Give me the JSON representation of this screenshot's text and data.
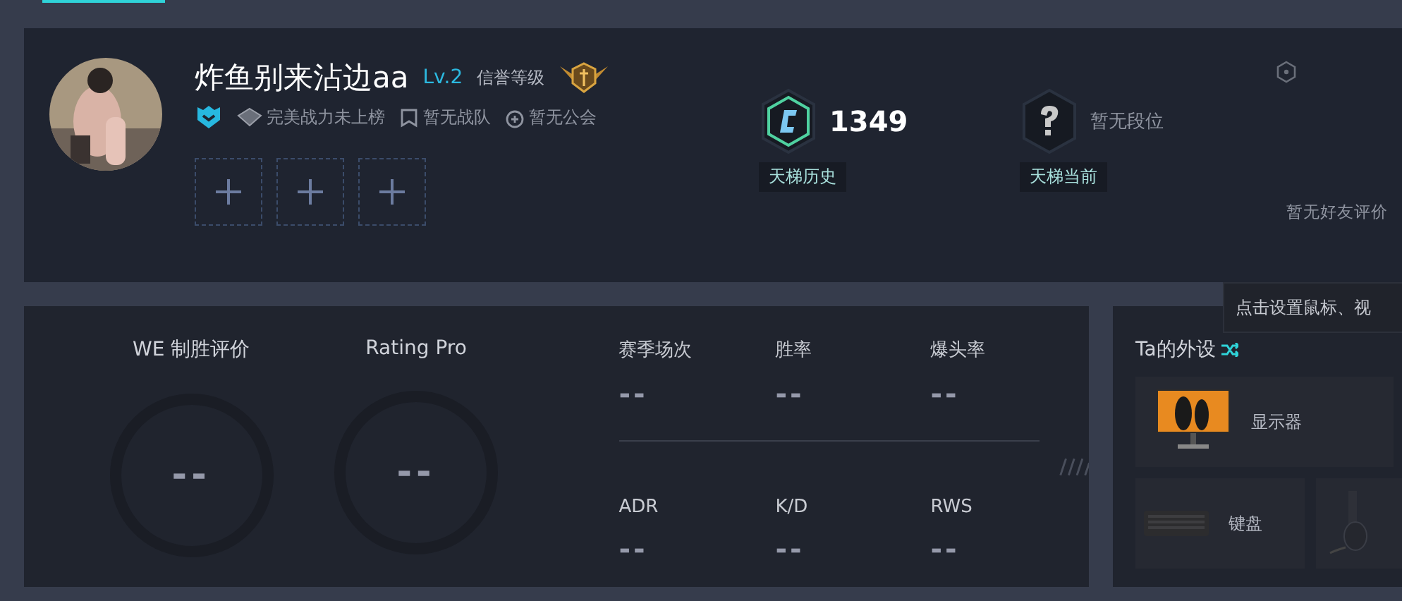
{
  "profile": {
    "name": "炸鱼别来沾边aa",
    "level_text": "Lv.2",
    "credit_label": "信誉等级",
    "badges": [
      {
        "kind": "power",
        "text": "完美战力未上榜"
      },
      {
        "kind": "team",
        "text": "暂无战队"
      },
      {
        "kind": "guild",
        "text": "暂无公会"
      }
    ],
    "slots": [
      {
        "kind": "empty"
      },
      {
        "kind": "empty"
      },
      {
        "kind": "empty"
      }
    ]
  },
  "ladder": [
    {
      "kind": "rank_c",
      "value": "1349",
      "label": "天梯历史"
    },
    {
      "kind": "unknown",
      "value": "暂无段位",
      "label": "天梯当前"
    }
  ],
  "friend_review": "暂无好友评价",
  "ratings": [
    {
      "title": "WE 制胜评价",
      "value": "--"
    },
    {
      "title": "Rating Pro",
      "value": "--"
    }
  ],
  "stats": [
    {
      "label": "赛季场次",
      "value": "--"
    },
    {
      "label": "胜率",
      "value": "--"
    },
    {
      "label": "爆头率",
      "value": "--"
    },
    {
      "label": "ADR",
      "value": "--"
    },
    {
      "label": "K/D",
      "value": "--"
    },
    {
      "label": "RWS",
      "value": "--"
    }
  ],
  "gear": {
    "title": "Ta的外设",
    "items": [
      {
        "kind": "monitor",
        "name": "显示器"
      },
      {
        "kind": "keyboard",
        "name": "键盘"
      },
      {
        "kind": "headset"
      }
    ]
  },
  "tooltip": "点击设置鼠标、视"
}
